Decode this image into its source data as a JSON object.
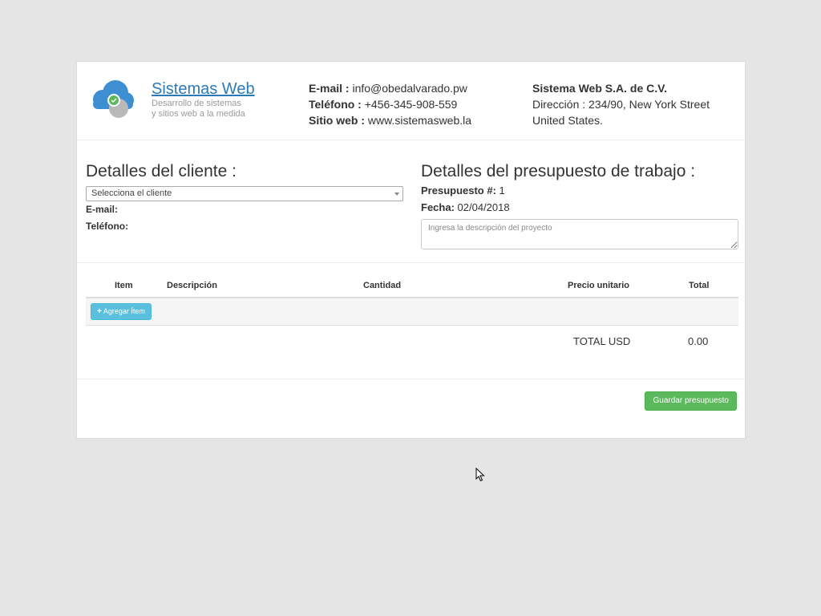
{
  "brand": {
    "name": "Sistemas Web",
    "tagline_1": "Desarrollo de sistemas",
    "tagline_2": "y sitios web a la medida"
  },
  "contact": {
    "email_label": "E-mail :",
    "email_value": "info@obedalvarado.pw",
    "phone_label": "Teléfono :",
    "phone_value": "+456-345-908-559",
    "site_label": "Sitio web :",
    "site_value": "www.sistemasweb.la"
  },
  "company": {
    "name": "Sistema Web S.A. de C.V.",
    "address_label": "Dirección :",
    "address_value": "234/90, New York Street",
    "country": "United States."
  },
  "client": {
    "title": "Detalles del cliente :",
    "select_value": "Selecciona el cliente",
    "email_label": "E-mail:",
    "phone_label": "Teléfono:"
  },
  "budget": {
    "title": "Detalles del presupuesto de trabajo :",
    "number_label": "Presupuesto #:",
    "number_value": "1",
    "date_label": "Fecha:",
    "date_value": "02/04/2018",
    "description_placeholder": "Ingresa la descripción del proyecto"
  },
  "table": {
    "headers": {
      "item": "Item",
      "description": "Descripción",
      "quantity": "Cantidad",
      "unit_price": "Precio unitario",
      "total": "Total"
    },
    "add_button": "Agregar Ítem",
    "total_label": "TOTAL USD",
    "total_value": "0.00"
  },
  "actions": {
    "save_button": "Guardar presupuesto"
  },
  "colors": {
    "brand_blue": "#2a7ab8",
    "info_button": "#5bc0de",
    "success_button": "#5cb85c",
    "page_background": "#e5e5e5"
  },
  "icons": {
    "logo": "cloud-logo-icon",
    "add": "plus-icon",
    "cursor": "mouse-cursor-icon"
  }
}
